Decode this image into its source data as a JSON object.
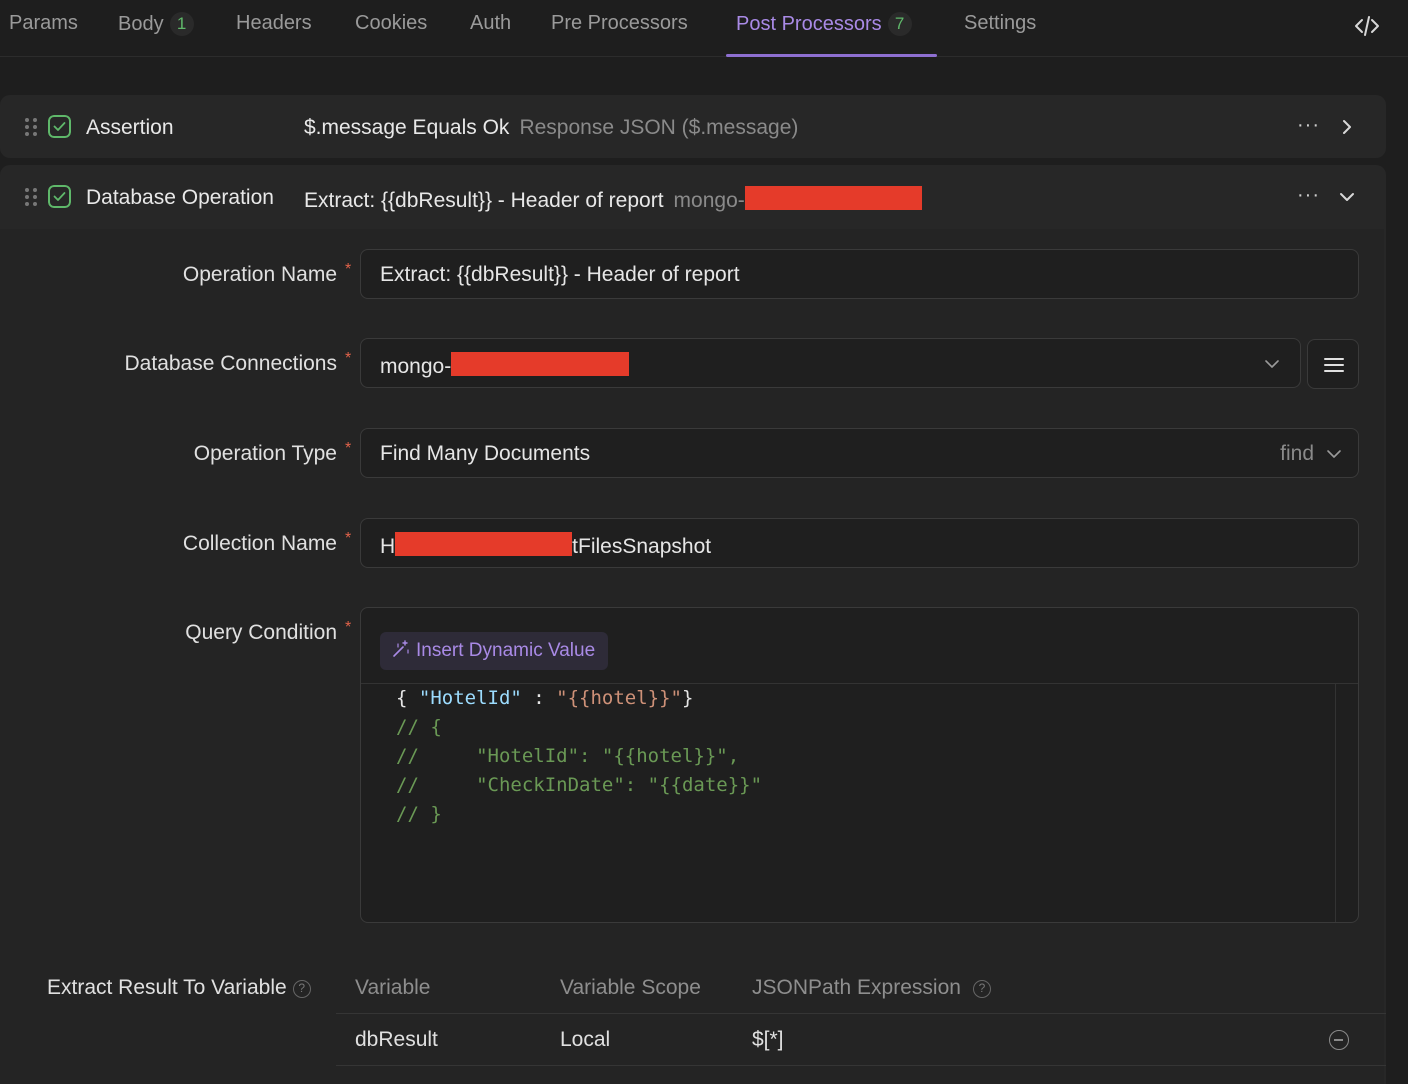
{
  "tabs": [
    {
      "label": "Params",
      "badge": ""
    },
    {
      "label": "Body",
      "badge": "1"
    },
    {
      "label": "Headers",
      "badge": ""
    },
    {
      "label": "Cookies",
      "badge": ""
    },
    {
      "label": "Auth",
      "badge": ""
    },
    {
      "label": "Pre Processors",
      "badge": ""
    },
    {
      "label": "Post Processors",
      "badge": "7",
      "active": true
    },
    {
      "label": "Settings",
      "badge": ""
    }
  ],
  "processors": {
    "assertion": {
      "title": "Assertion",
      "summary": "$.message Equals Ok",
      "summary_muted": "Response JSON ($.message)",
      "more": "···"
    },
    "db_operation": {
      "title": "Database Operation",
      "summary": "Extract: {{dbResult}} - Header of report",
      "summary_muted": "mongo-",
      "more": "···"
    }
  },
  "form": {
    "operation_name": {
      "label": "Operation Name",
      "value": "Extract: {{dbResult}} - Header of report"
    },
    "db_connections": {
      "label": "Database Connections",
      "value": "mongo-"
    },
    "operation_type": {
      "label": "Operation Type",
      "value": "Find Many Documents",
      "method": "find"
    },
    "collection_name": {
      "label": "Collection Name",
      "value_prefix": "H",
      "value_suffix": "tFilesSnapshot"
    },
    "query_condition": {
      "label": "Query Condition",
      "insert_label": "Insert Dynamic Value"
    },
    "required_mark": "*"
  },
  "extract": {
    "label": "Extract Result To Variable",
    "columns": [
      "Variable",
      "Variable Scope",
      "JSONPath Expression"
    ],
    "rows": [
      {
        "variable": "dbResult",
        "scope": "Local",
        "jsonpath": "$[*]"
      }
    ]
  },
  "colors": {
    "accent": "#a98ae6",
    "success": "#5fb86a",
    "redaction": "#e53b2a",
    "background": "#1e1e1e"
  }
}
